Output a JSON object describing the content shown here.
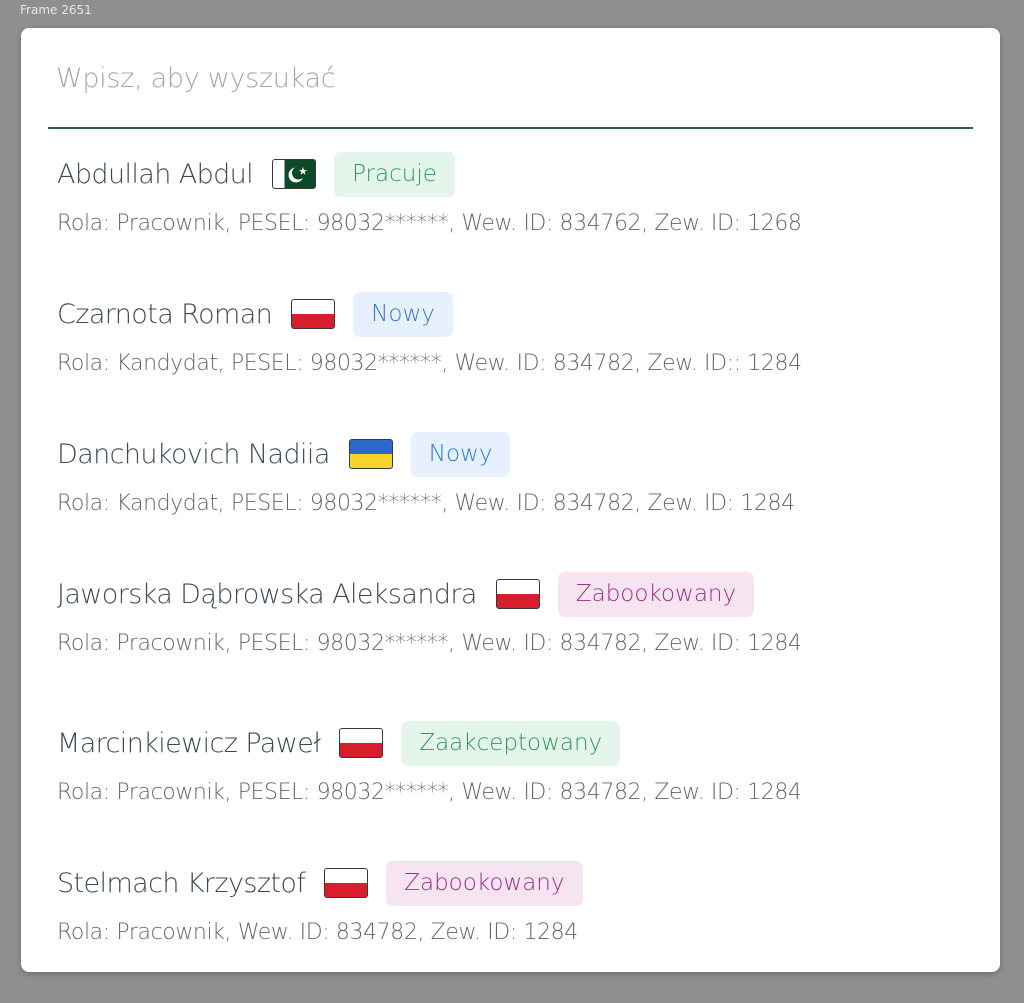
{
  "frame_label": "Frame 2651",
  "search": {
    "placeholder": "Wpisz, aby wyszukać",
    "value": ""
  },
  "status_colors": {
    "Pracuje": {
      "bg": "#e4f6ec",
      "fg": "#2e9a58"
    },
    "Nowy": {
      "bg": "#e7f1fd",
      "fg": "#2f7bd8"
    },
    "Zabookowany": {
      "bg": "#f6e5f1",
      "fg": "#9b2f8c"
    },
    "Zaakceptowany": {
      "bg": "#e4f6ec",
      "fg": "#2e9a58"
    }
  },
  "people": [
    {
      "name": "Abdullah Abdul",
      "flag": "pakistan-flag",
      "status": "Pracuje",
      "details": "Rola: Pracownik, PESEL: 98032******, Wew. ID: 834762, Zew. ID: 1268"
    },
    {
      "name": "Czarnota Roman",
      "flag": "poland-flag",
      "status": "Nowy",
      "details": "Rola: Kandydat, PESEL: 98032******, Wew. ID: 834782, Zew. ID:: 1284"
    },
    {
      "name": "Danchukovich Nadiia",
      "flag": "ukraine-flag",
      "status": "Nowy",
      "details": "Rola: Kandydat, PESEL: 98032******, Wew. ID: 834782, Zew. ID: 1284"
    },
    {
      "name": "Jaworska Dąbrowska Aleksandra",
      "flag": "poland-flag",
      "status": "Zabookowany",
      "details": "Rola: Pracownik, PESEL: 98032******, Wew. ID: 834782, Zew. ID: 1284"
    },
    {
      "name": "Marcinkiewicz Paweł",
      "flag": "poland-flag",
      "status": "Zaakceptowany",
      "details": "Rola: Pracownik, PESEL: 98032******,  Wew. ID: 834782, Zew. ID: 1284"
    },
    {
      "name": "Stelmach Krzysztof",
      "flag": "poland-flag",
      "status": "Zabookowany",
      "details": "Rola: Pracownik, Wew. ID: 834782, Zew. ID: 1284"
    }
  ]
}
